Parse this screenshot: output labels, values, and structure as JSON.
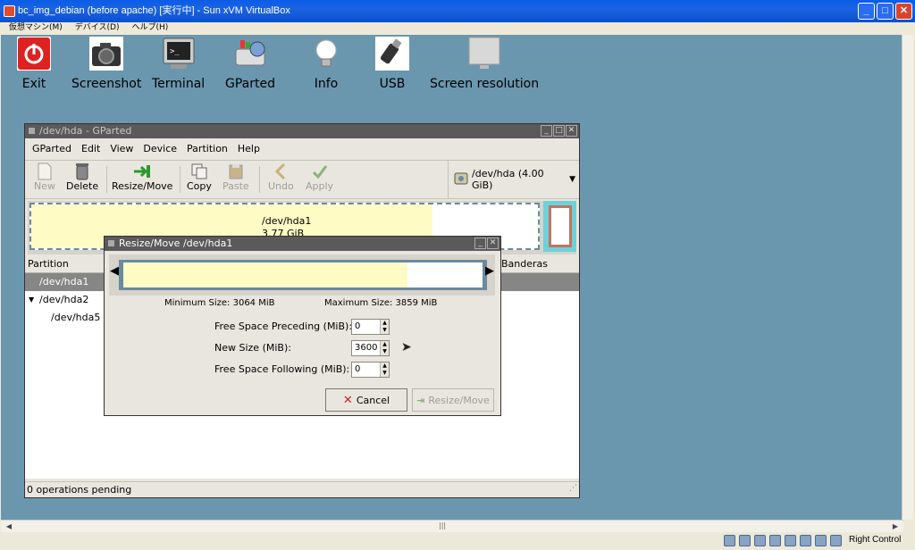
{
  "host": {
    "title": "bc_img_debian (before apache) [実行中] - Sun xVM VirtualBox",
    "menu": [
      "仮想マシン(M)",
      "デバイス(D)",
      "ヘルプ(H)"
    ],
    "status_right": "Right Control",
    "buttons": {
      "minimize": "_",
      "maximize": "□",
      "close": "✕"
    }
  },
  "launcher": [
    {
      "label": "Exit",
      "icon": "power-icon"
    },
    {
      "label": "Screenshot",
      "icon": "camera-icon"
    },
    {
      "label": "Terminal",
      "icon": "terminal-icon"
    },
    {
      "label": "GParted",
      "icon": "gparted-icon"
    },
    {
      "label": "Info",
      "icon": "lightbulb-icon"
    },
    {
      "label": "USB",
      "icon": "usb-icon"
    },
    {
      "label": "Screen resolution",
      "icon": "monitor-icon"
    }
  ],
  "gparted": {
    "title": "/dev/hda - GParted",
    "menu": [
      "GParted",
      "Edit",
      "View",
      "Device",
      "Partition",
      "Help"
    ],
    "toolbar": {
      "new": "New",
      "delete": "Delete",
      "resize": "Resize/Move",
      "copy": "Copy",
      "paste": "Paste",
      "undo": "Undo",
      "apply": "Apply"
    },
    "device": "/dev/hda  (4.00 GiB)",
    "disk": {
      "partition": "/dev/hda1",
      "size": "3.77 GiB",
      "used_fraction": 0.79
    },
    "columns": {
      "partition": "Partition",
      "flags": "Banderas"
    },
    "rows": [
      "/dev/hda1",
      "/dev/hda2",
      "/dev/hda5"
    ],
    "status": "0 operations pending"
  },
  "dialog": {
    "title": "Resize/Move /dev/hda1",
    "min_size": "Minimum Size: 3064 MiB",
    "max_size": "Maximum Size: 3859 MiB",
    "preceding_label": "Free Space Preceding (MiB):",
    "preceding_value": "0",
    "newsize_label": "New Size (MiB):",
    "newsize_value": "3600",
    "following_label": "Free Space Following (MiB):",
    "following_value": "0",
    "cancel": "Cancel",
    "resize": "Resize/Move",
    "fill_fraction": 0.79
  },
  "colors": {
    "guest_bg": "#6a97ae",
    "partition_fill": "#fffbc4",
    "border_accent": "#6a8aa0"
  }
}
